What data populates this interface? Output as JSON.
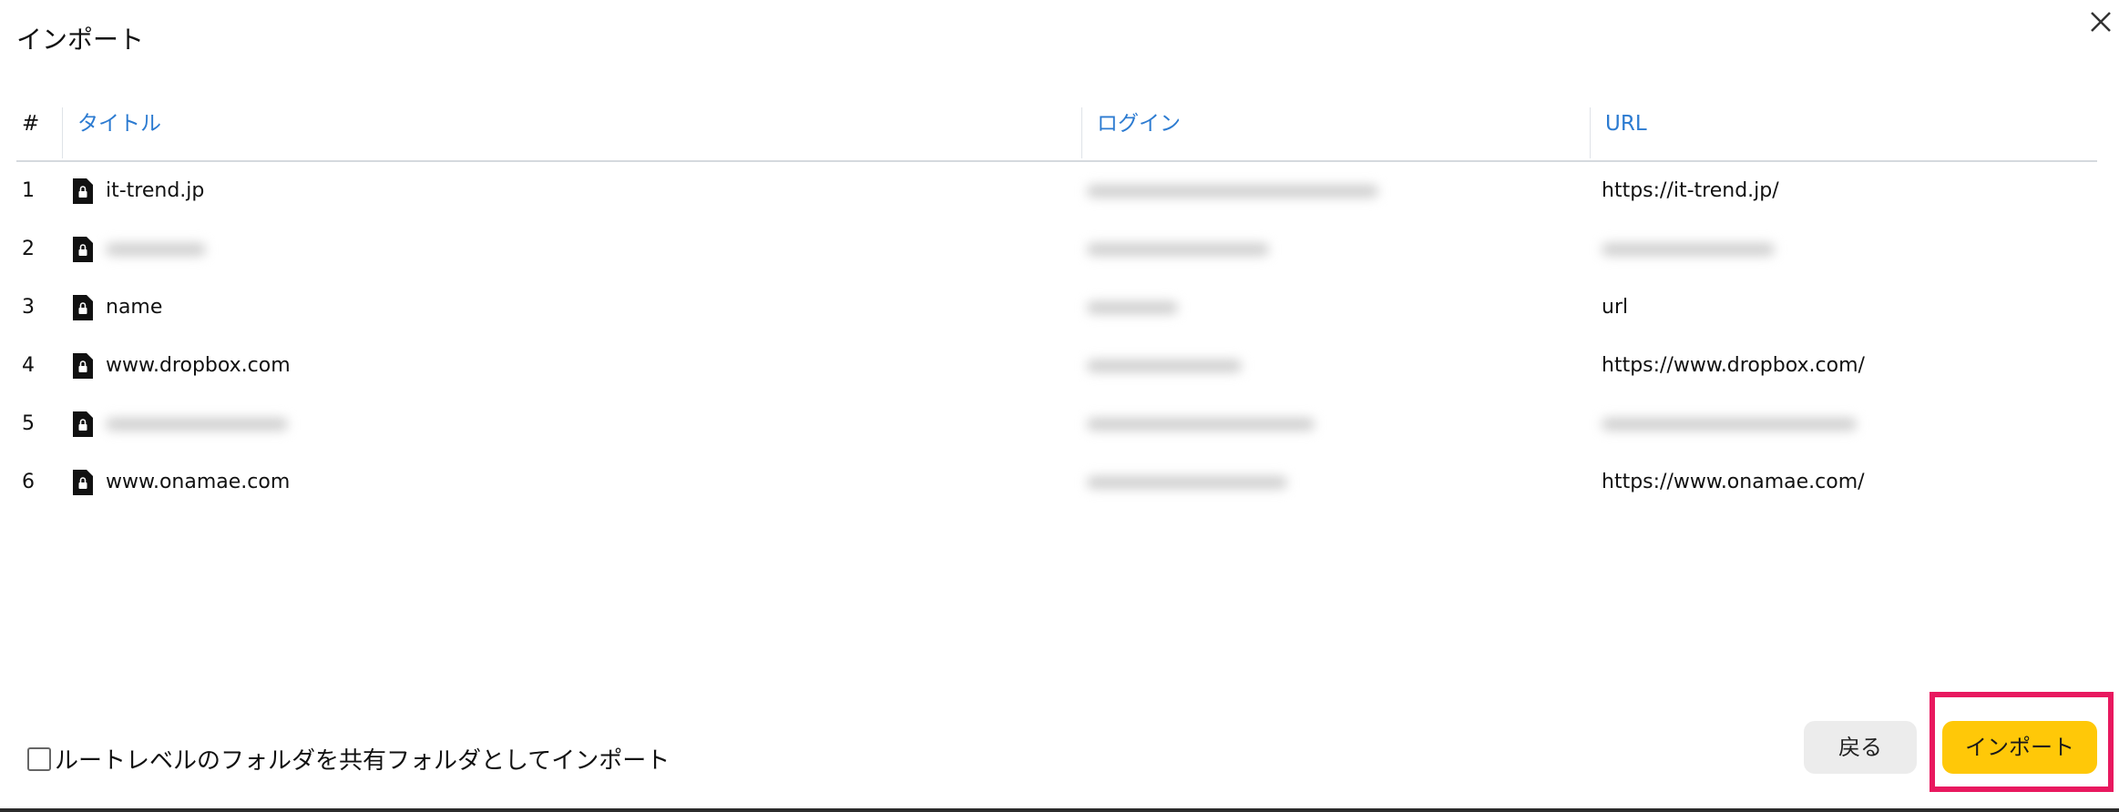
{
  "dialog": {
    "title": "インポート",
    "close_icon": "close-icon"
  },
  "table": {
    "headers": {
      "num": "#",
      "title": "タイトル",
      "login": "ログイン",
      "url": "URL"
    },
    "rows": [
      {
        "num": "1",
        "title": "it-trend.jp",
        "login": "",
        "url": "https://it-trend.jp/"
      },
      {
        "num": "2",
        "title": "",
        "login": "",
        "url": ""
      },
      {
        "num": "3",
        "title": "name",
        "login": "",
        "url": "url"
      },
      {
        "num": "4",
        "title": "www.dropbox.com",
        "login": "",
        "url": "https://www.dropbox.com/"
      },
      {
        "num": "5",
        "title": "",
        "login": "",
        "url": ""
      },
      {
        "num": "6",
        "title": "www.onamae.com",
        "login": "",
        "url": "https://www.onamae.com/"
      }
    ]
  },
  "footer": {
    "checkbox_label": "ルートレベルのフォルダを共有フォルダとしてインポート",
    "checkbox_checked": false,
    "back_label": "戻る",
    "import_label": "インポート"
  },
  "colors": {
    "accent": "#2c7bd1",
    "primary_button": "#ffc808",
    "highlight": "#e8195f"
  }
}
